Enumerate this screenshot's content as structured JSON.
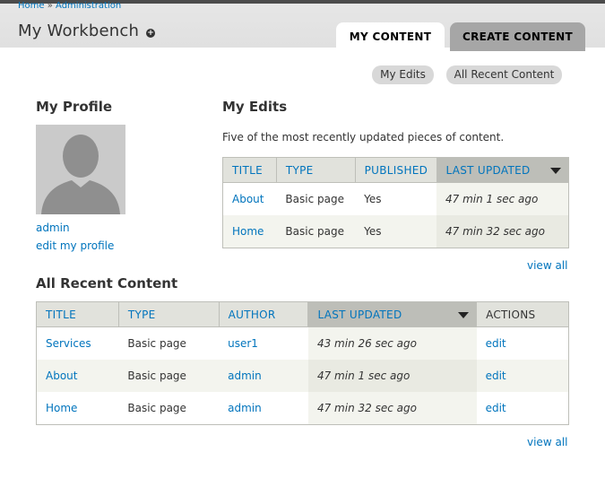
{
  "breadcrumb": {
    "home": "Home",
    "sep": "»",
    "admin": "Administration"
  },
  "title": "My Workbench",
  "add_icon": "+",
  "tabs": {
    "my_content": "MY CONTENT",
    "create_content": "CREATE CONTENT"
  },
  "secondary": {
    "my_edits": "My Edits",
    "all_recent": "All Recent Content"
  },
  "profile": {
    "heading": "My Profile",
    "username": "admin",
    "edit_link": "edit my profile"
  },
  "my_edits": {
    "heading": "My Edits",
    "description": "Five of the most recently updated pieces of content.",
    "headers": {
      "title": "TITLE",
      "type": "TYPE",
      "published": "PUBLISHED",
      "updated": "LAST UPDATED"
    },
    "rows": [
      {
        "title": "About",
        "type": "Basic page",
        "published": "Yes",
        "updated": "47 min 1 sec ago"
      },
      {
        "title": "Home",
        "type": "Basic page",
        "published": "Yes",
        "updated": "47 min 32 sec ago"
      }
    ],
    "view_all": "view all"
  },
  "recent": {
    "heading": "All Recent Content",
    "headers": {
      "title": "TITLE",
      "type": "TYPE",
      "author": "AUTHOR",
      "updated": "LAST UPDATED",
      "actions": "ACTIONS"
    },
    "rows": [
      {
        "title": "Services",
        "type": "Basic page",
        "author": "user1",
        "updated": "43 min 26 sec ago",
        "action": "edit"
      },
      {
        "title": "About",
        "type": "Basic page",
        "author": "admin",
        "updated": "47 min 1 sec ago",
        "action": "edit"
      },
      {
        "title": "Home",
        "type": "Basic page",
        "author": "admin",
        "updated": "47 min 32 sec ago",
        "action": "edit"
      }
    ],
    "view_all": "view all"
  }
}
